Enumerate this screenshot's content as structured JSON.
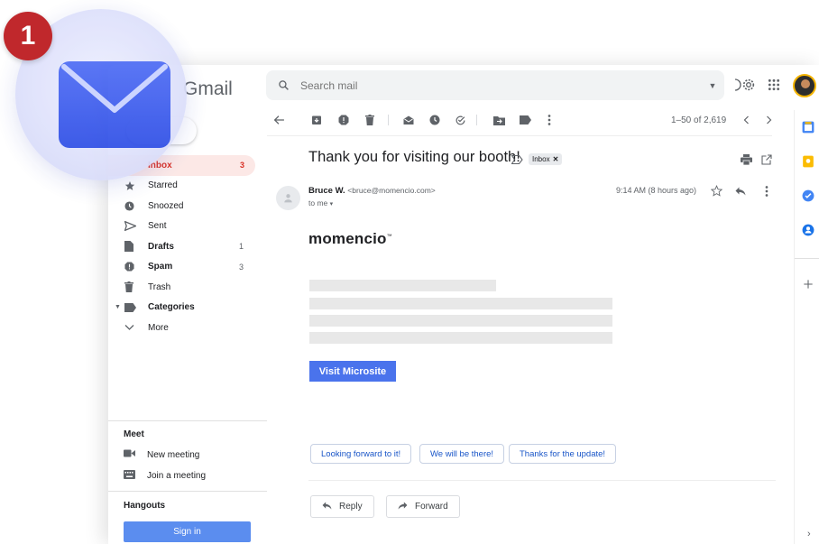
{
  "header": {
    "app_name": "Gmail",
    "search_placeholder": "Search mail"
  },
  "sidebar": {
    "items": [
      {
        "label": "Inbox",
        "count": "3",
        "icon": "inbox-icon"
      },
      {
        "label": "Starred",
        "count": "",
        "icon": "star-icon"
      },
      {
        "label": "Snoozed",
        "count": "",
        "icon": "clock-icon"
      },
      {
        "label": "Sent",
        "count": "",
        "icon": "send-icon"
      },
      {
        "label": "Drafts",
        "count": "1",
        "icon": "draft-icon"
      },
      {
        "label": "Spam",
        "count": "3",
        "icon": "spam-icon"
      },
      {
        "label": "Trash",
        "count": "",
        "icon": "trash-icon"
      },
      {
        "label": "Categories",
        "count": "",
        "icon": "label-icon"
      },
      {
        "label": "More",
        "count": "",
        "icon": "chevron-down-icon"
      }
    ],
    "meet": {
      "title": "Meet",
      "new_meeting": "New meeting",
      "join_meeting": "Join a meeting"
    },
    "hangouts": {
      "title": "Hangouts",
      "sign_in": "Sign in"
    }
  },
  "toolbar": {
    "pager": "1–50 of 2,619"
  },
  "message": {
    "subject": "Thank you for visiting our booth!",
    "label": "Inbox",
    "sender_name": "Bruce W.",
    "sender_email": "<bruce@momencio.com>",
    "to": "to me",
    "time": "9:14 AM (8 hours ago)",
    "brand": "momencio",
    "cta_label": "Visit Microsite"
  },
  "smart_replies": [
    "Looking forward to it!",
    "We will be there!",
    "Thanks for the update!"
  ],
  "actions": {
    "reply": "Reply",
    "forward": "Forward"
  },
  "overlay": {
    "badge_number": "1"
  },
  "colors": {
    "accent_red": "#d93025",
    "badge_red": "#c0282c",
    "cta_blue": "#4a73ec",
    "envelope_blue": "#3d5cf0"
  }
}
